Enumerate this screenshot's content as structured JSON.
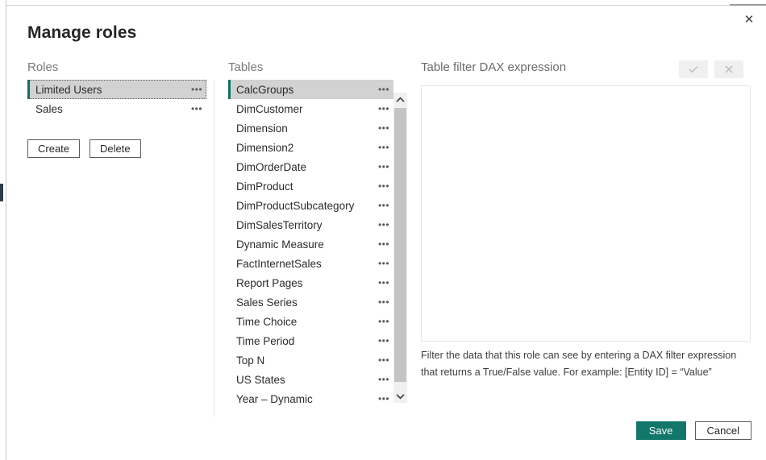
{
  "dialog": {
    "title": "Manage roles",
    "close_label": "✕"
  },
  "roles_panel": {
    "heading": "Roles",
    "items": [
      {
        "label": "Limited Users",
        "selected": true,
        "menu": "•••"
      },
      {
        "label": "Sales",
        "selected": false,
        "menu": "•••"
      }
    ],
    "create_label": "Create",
    "delete_label": "Delete"
  },
  "tables_panel": {
    "heading": "Tables",
    "items": [
      {
        "label": "CalcGroups",
        "selected": true,
        "menu": "•••"
      },
      {
        "label": "DimCustomer",
        "selected": false,
        "menu": "•••"
      },
      {
        "label": "Dimension",
        "selected": false,
        "menu": "•••"
      },
      {
        "label": "Dimension2",
        "selected": false,
        "menu": "•••"
      },
      {
        "label": "DimOrderDate",
        "selected": false,
        "menu": "•••"
      },
      {
        "label": "DimProduct",
        "selected": false,
        "menu": "•••"
      },
      {
        "label": "DimProductSubcategory",
        "selected": false,
        "menu": "•••"
      },
      {
        "label": "DimSalesTerritory",
        "selected": false,
        "menu": "•••"
      },
      {
        "label": "Dynamic Measure",
        "selected": false,
        "menu": "•••"
      },
      {
        "label": "FactInternetSales",
        "selected": false,
        "menu": "•••"
      },
      {
        "label": "Report Pages",
        "selected": false,
        "menu": "•••"
      },
      {
        "label": "Sales Series",
        "selected": false,
        "menu": "•••"
      },
      {
        "label": "Time Choice",
        "selected": false,
        "menu": "•••"
      },
      {
        "label": "Time Period",
        "selected": false,
        "menu": "•••"
      },
      {
        "label": "Top N",
        "selected": false,
        "menu": "•••"
      },
      {
        "label": "US States",
        "selected": false,
        "menu": "•••"
      },
      {
        "label": "Year – Dynamic",
        "selected": false,
        "menu": "•••"
      }
    ]
  },
  "dax_panel": {
    "heading": "Table filter DAX expression",
    "accept_label": "✓",
    "reject_label": "✕",
    "expression_value": "",
    "expression_placeholder": "",
    "help_text": "Filter the data that this role can see by entering a DAX filter expression that returns a True/False value. For example: [Entity ID] = “Value”"
  },
  "footer": {
    "save_label": "Save",
    "cancel_label": "Cancel"
  },
  "colors": {
    "accent_teal": "#12776a",
    "selection_gray": "#d2d2d2",
    "heading_gray": "#7a7a7a"
  }
}
